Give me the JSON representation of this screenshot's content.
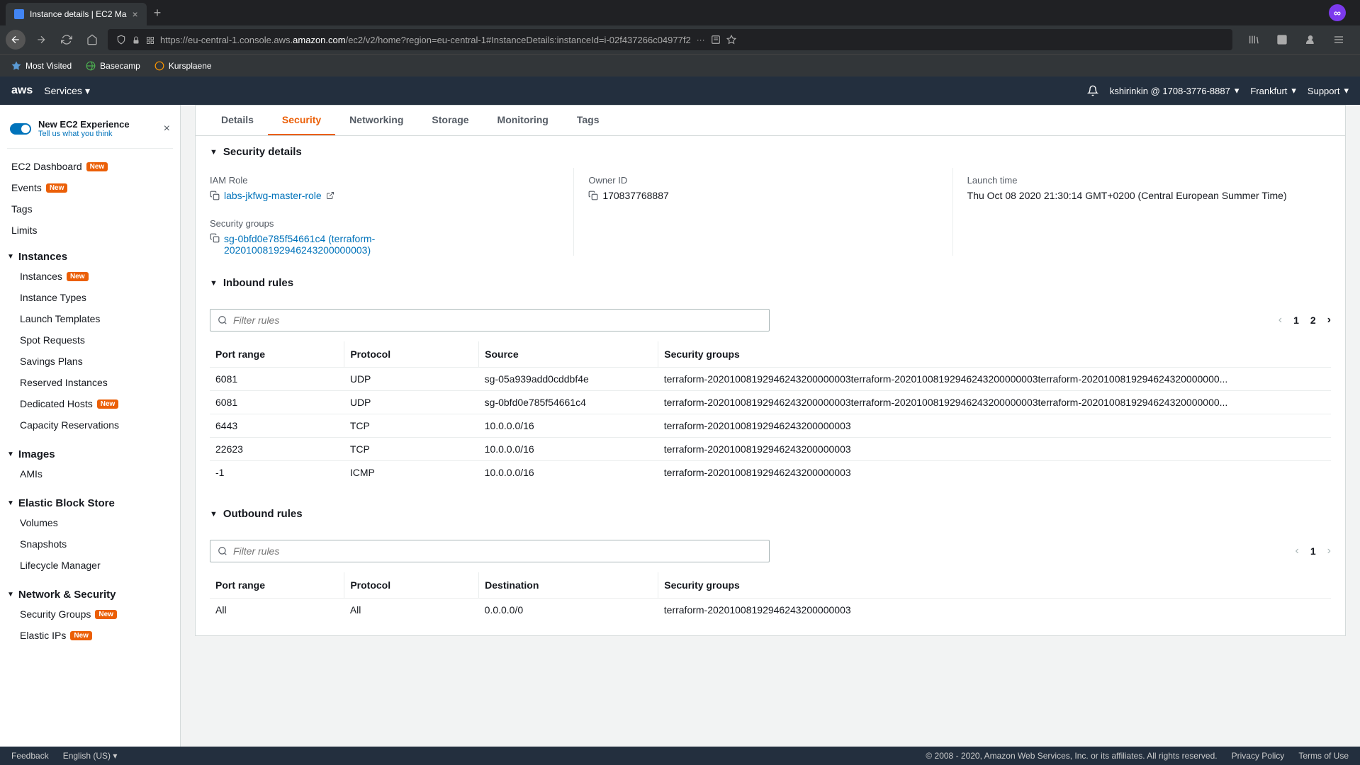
{
  "browser": {
    "tab_title": "Instance details | EC2 Ma",
    "url_prefix": "https://eu-central-1.console.aws.",
    "url_domain": "amazon.com",
    "url_suffix": "/ec2/v2/home?region=eu-central-1#InstanceDetails:instanceId=i-02f437266c04977f2",
    "bookmarks": [
      {
        "label": "Most Visited"
      },
      {
        "label": "Basecamp"
      },
      {
        "label": "Kursplaene"
      }
    ]
  },
  "aws_header": {
    "services": "Services",
    "user": "kshirinkin @ 1708-3776-8887",
    "region": "Frankfurt",
    "support": "Support"
  },
  "sidebar": {
    "new_ec2": {
      "title": "New EC2 Experience",
      "subtitle": "Tell us what you think"
    },
    "top_links": [
      {
        "label": "EC2 Dashboard",
        "badge": "New"
      },
      {
        "label": "Events",
        "badge": "New"
      },
      {
        "label": "Tags",
        "badge": ""
      },
      {
        "label": "Limits",
        "badge": ""
      }
    ],
    "groups": [
      {
        "title": "Instances",
        "items": [
          {
            "label": "Instances",
            "badge": "New"
          },
          {
            "label": "Instance Types",
            "badge": ""
          },
          {
            "label": "Launch Templates",
            "badge": ""
          },
          {
            "label": "Spot Requests",
            "badge": ""
          },
          {
            "label": "Savings Plans",
            "badge": ""
          },
          {
            "label": "Reserved Instances",
            "badge": ""
          },
          {
            "label": "Dedicated Hosts",
            "badge": "New"
          },
          {
            "label": "Capacity Reservations",
            "badge": ""
          }
        ]
      },
      {
        "title": "Images",
        "items": [
          {
            "label": "AMIs",
            "badge": ""
          }
        ]
      },
      {
        "title": "Elastic Block Store",
        "items": [
          {
            "label": "Volumes",
            "badge": ""
          },
          {
            "label": "Snapshots",
            "badge": ""
          },
          {
            "label": "Lifecycle Manager",
            "badge": ""
          }
        ]
      },
      {
        "title": "Network & Security",
        "items": [
          {
            "label": "Security Groups",
            "badge": "New"
          },
          {
            "label": "Elastic IPs",
            "badge": "New"
          }
        ]
      }
    ]
  },
  "tabs": [
    {
      "label": "Details",
      "active": false
    },
    {
      "label": "Security",
      "active": true
    },
    {
      "label": "Networking",
      "active": false
    },
    {
      "label": "Storage",
      "active": false
    },
    {
      "label": "Monitoring",
      "active": false
    },
    {
      "label": "Tags",
      "active": false
    }
  ],
  "security_details": {
    "header": "Security details",
    "iam_role_label": "IAM Role",
    "iam_role_value": "labs-jkfwg-master-role",
    "owner_id_label": "Owner ID",
    "owner_id_value": "170837768887",
    "launch_time_label": "Launch time",
    "launch_time_value": "Thu Oct 08 2020 21:30:14 GMT+0200 (Central European Summer Time)",
    "sg_label": "Security groups",
    "sg_value": "sg-0bfd0e785f54661c4 (terraform-20201008192946243200000003)"
  },
  "inbound": {
    "header": "Inbound rules",
    "filter_placeholder": "Filter rules",
    "pages": [
      "1",
      "2"
    ],
    "columns": [
      "Port range",
      "Protocol",
      "Source",
      "Security groups"
    ],
    "rows": [
      {
        "port": "6081",
        "proto": "UDP",
        "src": "sg-05a939add0cddbf4e",
        "sg": "terraform-20201008192946243200000003terraform-20201008192946243200000003terraform-2020100819294624320000000..."
      },
      {
        "port": "6081",
        "proto": "UDP",
        "src": "sg-0bfd0e785f54661c4",
        "sg": "terraform-20201008192946243200000003terraform-20201008192946243200000003terraform-2020100819294624320000000..."
      },
      {
        "port": "6443",
        "proto": "TCP",
        "src": "10.0.0.0/16",
        "sg": "terraform-20201008192946243200000003"
      },
      {
        "port": "22623",
        "proto": "TCP",
        "src": "10.0.0.0/16",
        "sg": "terraform-20201008192946243200000003"
      },
      {
        "port": "-1",
        "proto": "ICMP",
        "src": "10.0.0.0/16",
        "sg": "terraform-20201008192946243200000003"
      }
    ]
  },
  "outbound": {
    "header": "Outbound rules",
    "filter_placeholder": "Filter rules",
    "pages": [
      "1"
    ],
    "columns": [
      "Port range",
      "Protocol",
      "Destination",
      "Security groups"
    ],
    "rows": [
      {
        "port": "All",
        "proto": "All",
        "src": "0.0.0.0/0",
        "sg": "terraform-20201008192946243200000003"
      }
    ]
  },
  "footer": {
    "feedback": "Feedback",
    "language": "English (US)",
    "copyright": "© 2008 - 2020, Amazon Web Services, Inc. or its affiliates. All rights reserved.",
    "privacy": "Privacy Policy",
    "terms": "Terms of Use"
  }
}
